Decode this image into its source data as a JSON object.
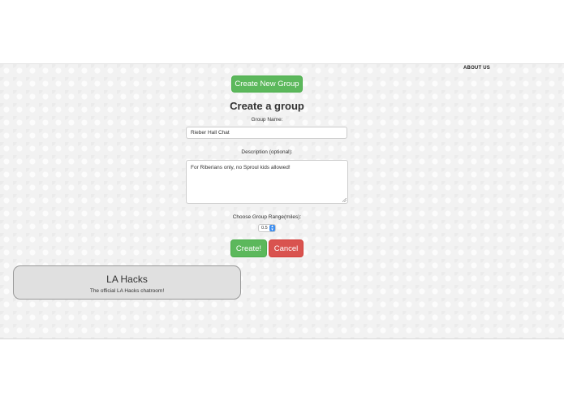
{
  "nav": {
    "about_label": "ABOUT US"
  },
  "toolbar": {
    "create_new_group_label": "Create New Group"
  },
  "form": {
    "title": "Create a group",
    "group_name_label": "Group Name:",
    "group_name_value": "Rieber Hall Chat",
    "description_label": "Description (optional):",
    "description_value": "For Riberians only, no Sproul kids allowed!",
    "range_label": "Choose Group Range(miles):",
    "range_value": "0.5",
    "create_label": "Create!",
    "cancel_label": "Cancel"
  },
  "groups": [
    {
      "name": "LA Hacks",
      "description": "The official LA Hacks chatroom!"
    }
  ],
  "colors": {
    "success": "#5cb85c",
    "danger": "#d9534f",
    "select_arrow": "#3d8ef0",
    "card_bg": "#e0e0e0"
  }
}
